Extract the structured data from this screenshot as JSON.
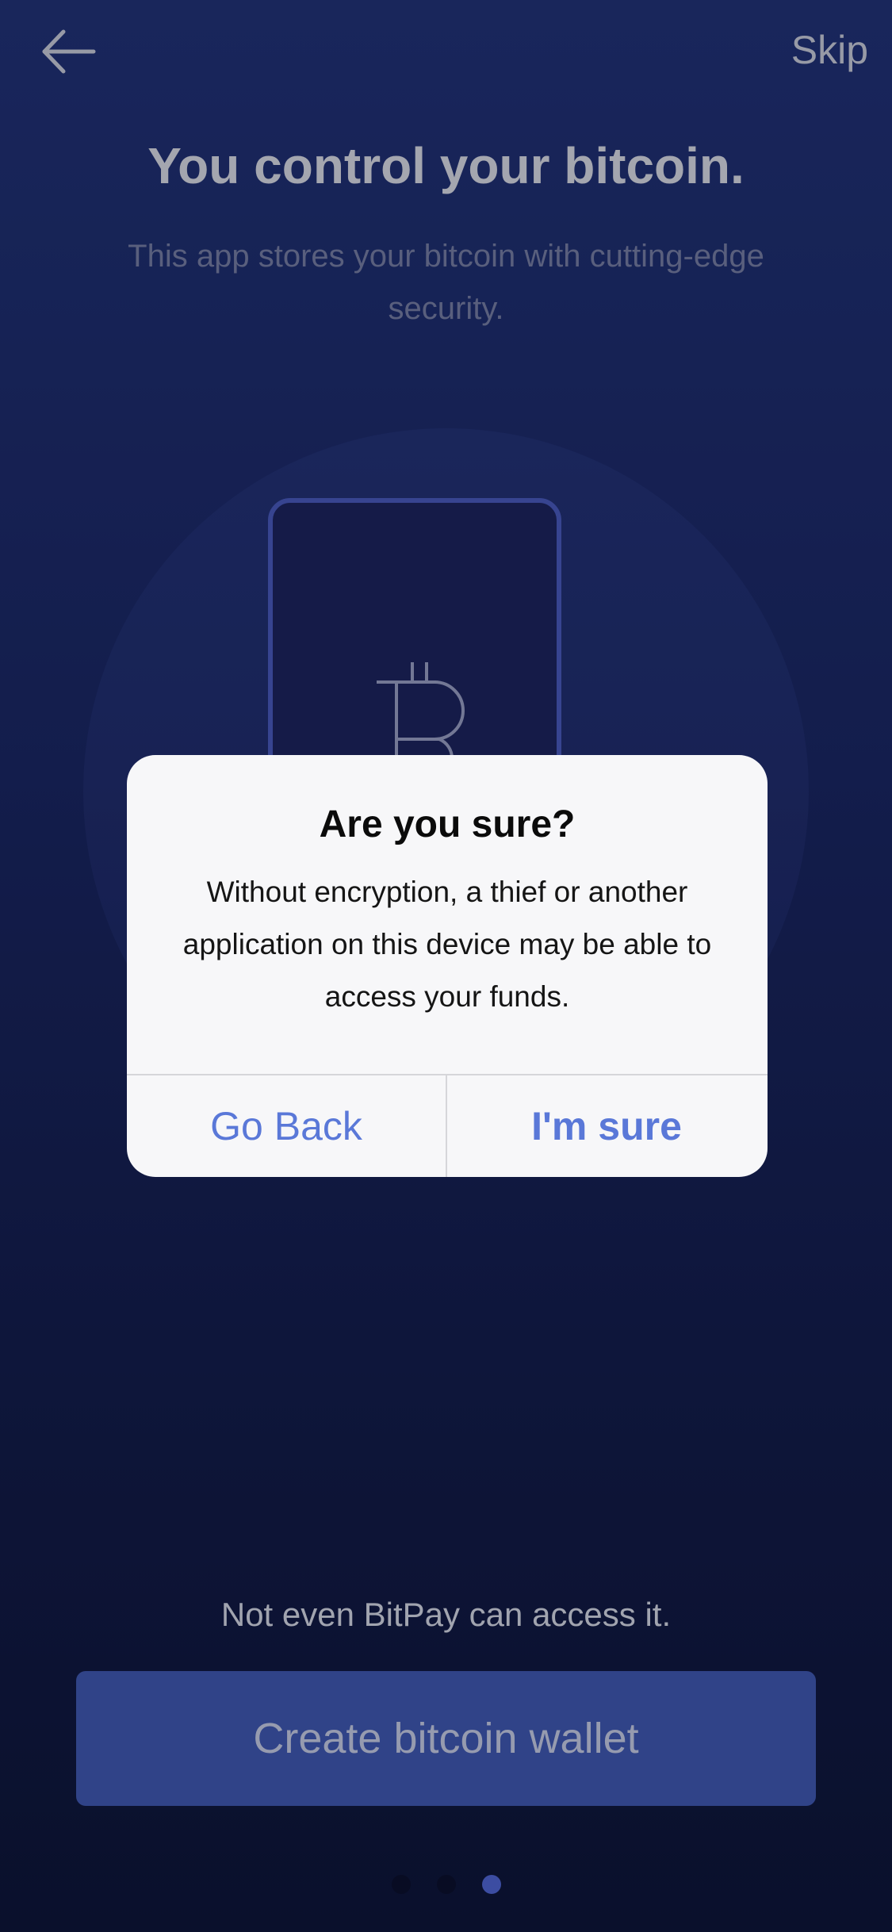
{
  "header": {
    "skip_label": "Skip"
  },
  "onboarding": {
    "title": "You control your bitcoin.",
    "subtitle": "This app stores your bitcoin with cutting-edge security.",
    "tagline": "Not even BitPay can access it.",
    "cta_label": "Create bitcoin wallet",
    "page_indicator": {
      "total": 3,
      "active_index": 2
    }
  },
  "dialog": {
    "title": "Are you sure?",
    "message": "Without encryption, a thief or another application on this device may be able to access your funds.",
    "go_back_label": "Go Back",
    "confirm_label": "I'm sure"
  },
  "colors": {
    "accent": "#5a78d8",
    "cta_background": "#3b52a6",
    "background_top": "#1f2f70",
    "background_bottom": "#0d1436"
  },
  "icons": {
    "back": "arrow-left-icon",
    "illustration": "bitcoin-icon"
  }
}
